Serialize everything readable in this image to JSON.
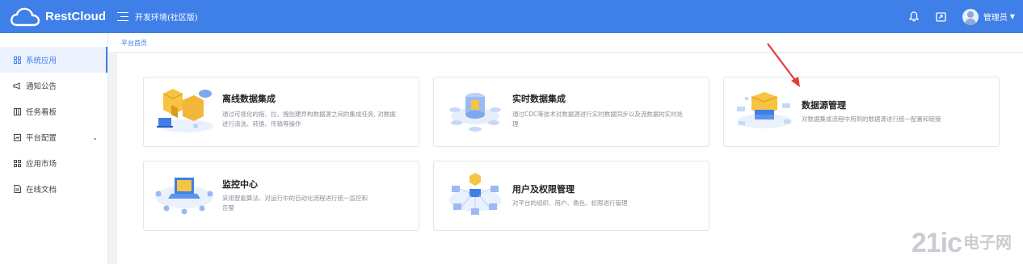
{
  "header": {
    "brand": "RestCloud",
    "env_label": "开发环境(社区版)",
    "user_name": "管理员"
  },
  "sidebar": {
    "items": [
      {
        "label": "系统应用",
        "icon": "grid-icon",
        "active": true
      },
      {
        "label": "通知公告",
        "icon": "megaphone-icon"
      },
      {
        "label": "任务看板",
        "icon": "board-icon"
      },
      {
        "label": "平台配置",
        "icon": "config-icon",
        "expandable": true
      },
      {
        "label": "应用市场",
        "icon": "grid-icon"
      },
      {
        "label": "在线文档",
        "icon": "doc-icon"
      }
    ]
  },
  "breadcrumb": {
    "current": "平台首页"
  },
  "cards": [
    {
      "title": "离线数据集成",
      "desc": "通过可视化的拖、拉、拽创建异构数据源之间的集成任务, 对数据进行清洗、转换、传输等操作"
    },
    {
      "title": "实时数据集成",
      "desc": "通过CDC等技术对数据源进行实时数据同步以及流数据的实时处理"
    },
    {
      "title": "数据源管理",
      "desc": "对数据集成流程中用到的数据源进行统一配置和链接"
    },
    {
      "title": "监控中心",
      "desc": "采用智能算法、对运行中的自动化流程进行统一监控和告警"
    },
    {
      "title": "用户及权限管理",
      "desc": "对平台的组织、用户、角色、权限进行管理"
    }
  ],
  "watermark": {
    "brand": "21ic",
    "cn": "电子网"
  },
  "colors": {
    "primary": "#3f7fe8",
    "annotation_arrow": "#e53935"
  }
}
